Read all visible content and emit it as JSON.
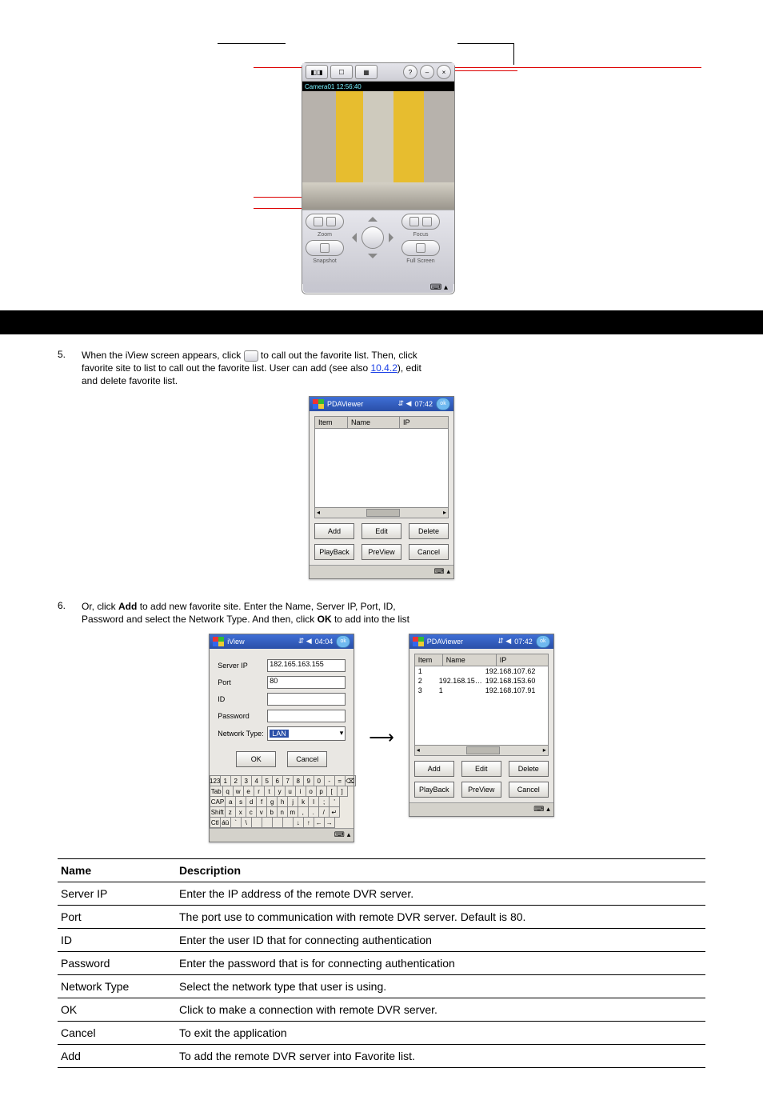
{
  "device_preview": {
    "camera_label": "Camera01  12:56:40",
    "zoom_label": "Zoom",
    "snapshot_label": "Snapshot",
    "focus_label": "Focus",
    "fullscreen_label": "Full Screen"
  },
  "step5": {
    "num": "5.",
    "text_before": "When the iView screen appears, click ",
    "favorite_icon": "Favorite icon",
    "text_after": " to call out the favorite list. Then, click favorite site to list to call out the favorite list. User can add (see also ",
    "link": "10.4.2",
    "after_link": "), edit and delete favorite list."
  },
  "mini1": {
    "title": "PDAViewer",
    "time": "07:42",
    "ok": "ok",
    "cols": {
      "item": "Item",
      "name": "Name",
      "ip": "IP"
    },
    "btns": {
      "add": "Add",
      "edit": "Edit",
      "delete": "Delete",
      "playback": "PlayBack",
      "preview": "PreView",
      "cancel": "Cancel"
    },
    "taskbar_keyboard": "⌨"
  },
  "step6": {
    "num": "6.",
    "text_a": "Or, click ",
    "text_b": " to add new favorite site. Enter the Name, Server IP, Port, ID, Password and select the Network Type. And then, click ",
    "add_word": "Add",
    "ok_word": "OK",
    "text_c": " to add into the list"
  },
  "mini2": {
    "title": "iView",
    "time": "04:04",
    "fields": {
      "server_ip_label": "Server IP",
      "server_ip_value": "182.165.163.155",
      "port_label": "Port",
      "port_value": "80",
      "id_label": "ID",
      "password_label": "Password",
      "network_label": "Network Type:",
      "network_value": "LAN"
    },
    "btns": {
      "ok": "OK",
      "cancel": "Cancel"
    },
    "kb_rows": [
      [
        "123",
        "1",
        "2",
        "3",
        "4",
        "5",
        "6",
        "7",
        "8",
        "9",
        "0",
        "-",
        "=",
        "⌫"
      ],
      [
        "Tab",
        "q",
        "w",
        "e",
        "r",
        "t",
        "y",
        "u",
        "i",
        "o",
        "p",
        "[",
        "]"
      ],
      [
        "CAP",
        "a",
        "s",
        "d",
        "f",
        "g",
        "h",
        "j",
        "k",
        "l",
        ";",
        "'"
      ],
      [
        "Shift",
        "z",
        "x",
        "c",
        "v",
        "b",
        "n",
        "m",
        ",",
        ".",
        "/",
        "↵"
      ],
      [
        "Ctl",
        "áü",
        "`",
        "\\",
        "",
        "",
        "",
        "",
        "↓",
        "↑",
        "←",
        "→"
      ]
    ]
  },
  "mini3": {
    "title": "PDAViewer",
    "time": "07:42",
    "rows": [
      {
        "item": "1",
        "name": "",
        "ip": "192.168.107.62"
      },
      {
        "item": "2",
        "name": "192.168.15…",
        "ip": "192.168.153.60"
      },
      {
        "item": "3",
        "name": "1",
        "ip": "192.168.107.91"
      }
    ]
  },
  "table": {
    "header": {
      "name": "Name",
      "desc": "Description"
    },
    "rows": [
      {
        "n": "Server IP",
        "d": "Enter the IP address of the remote DVR server."
      },
      {
        "n": "Port",
        "d": "The port use to communication with remote DVR server. Default is 80."
      },
      {
        "n": "ID",
        "d": "Enter the user ID that for connecting authentication"
      },
      {
        "n": "Password",
        "d": "Enter the password that is for connecting authentication"
      },
      {
        "n": "Network Type",
        "d": "Select the network type that user is using."
      },
      {
        "n": "OK",
        "d": "Click to make a connection with remote DVR server."
      },
      {
        "n": "Cancel",
        "d": "To exit the application"
      },
      {
        "n": "Add",
        "d": "To add the remote DVR server into Favorite list."
      }
    ]
  }
}
